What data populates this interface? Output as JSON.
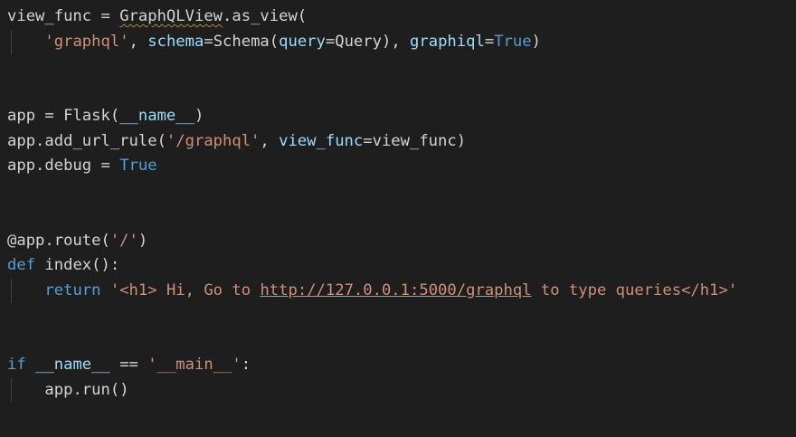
{
  "editor": {
    "background": "#1e1e1e",
    "colors": {
      "default": "#d4d4d4",
      "keyword": "#569cd6",
      "string": "#ce9178",
      "parameter": "#9cdcfe",
      "warning_squiggle": "#b0893e",
      "indent_guide": "#404040"
    },
    "lines": [
      {
        "tokens": [
          {
            "text": "view_func = ",
            "kind": "default"
          },
          {
            "text": "GraphQLView",
            "kind": "squiggle"
          },
          {
            "text": ".as_view(",
            "kind": "default"
          }
        ]
      },
      {
        "guide": true,
        "tokens": [
          {
            "text": "    ",
            "kind": "default"
          },
          {
            "text": "'graphql'",
            "kind": "string"
          },
          {
            "text": ", ",
            "kind": "default"
          },
          {
            "text": "schema",
            "kind": "param"
          },
          {
            "text": "=Schema(",
            "kind": "default"
          },
          {
            "text": "query",
            "kind": "param"
          },
          {
            "text": "=Query), ",
            "kind": "default"
          },
          {
            "text": "graphiql",
            "kind": "param"
          },
          {
            "text": "=",
            "kind": "default"
          },
          {
            "text": "True",
            "kind": "const"
          },
          {
            "text": ")",
            "kind": "default"
          }
        ]
      },
      {
        "tokens": []
      },
      {
        "tokens": []
      },
      {
        "tokens": [
          {
            "text": "app = Flask(",
            "kind": "default"
          },
          {
            "text": "__name__",
            "kind": "dunder"
          },
          {
            "text": ")",
            "kind": "default"
          }
        ]
      },
      {
        "tokens": [
          {
            "text": "app.add_url_rule(",
            "kind": "default"
          },
          {
            "text": "'/graphql'",
            "kind": "string"
          },
          {
            "text": ", ",
            "kind": "default"
          },
          {
            "text": "view_func",
            "kind": "param"
          },
          {
            "text": "=view_func)",
            "kind": "default"
          }
        ]
      },
      {
        "tokens": [
          {
            "text": "app.debug = ",
            "kind": "default"
          },
          {
            "text": "True",
            "kind": "const"
          }
        ]
      },
      {
        "tokens": []
      },
      {
        "tokens": []
      },
      {
        "tokens": [
          {
            "text": "@app.route(",
            "kind": "default"
          },
          {
            "text": "'/'",
            "kind": "string"
          },
          {
            "text": ")",
            "kind": "default"
          }
        ]
      },
      {
        "tokens": [
          {
            "text": "def",
            "kind": "keyword"
          },
          {
            "text": " index():",
            "kind": "default"
          }
        ]
      },
      {
        "guide": true,
        "tokens": [
          {
            "text": "    ",
            "kind": "default"
          },
          {
            "text": "return",
            "kind": "keyword"
          },
          {
            "text": " ",
            "kind": "default"
          },
          {
            "text": "'<h1> Hi, Go to ",
            "kind": "string"
          },
          {
            "text": "http://127.0.0.1:5000/graphql",
            "kind": "link"
          },
          {
            "text": " to type queries</h1>'",
            "kind": "string"
          }
        ]
      },
      {
        "tokens": []
      },
      {
        "tokens": []
      },
      {
        "tokens": [
          {
            "text": "if",
            "kind": "keyword"
          },
          {
            "text": " ",
            "kind": "default"
          },
          {
            "text": "__name__",
            "kind": "dunder"
          },
          {
            "text": " == ",
            "kind": "default"
          },
          {
            "text": "'__main__'",
            "kind": "string"
          },
          {
            "text": ":",
            "kind": "default"
          }
        ]
      },
      {
        "guide": true,
        "tokens": [
          {
            "text": "    ",
            "kind": "default"
          },
          {
            "text": "app.run()",
            "kind": "default"
          }
        ]
      }
    ]
  }
}
